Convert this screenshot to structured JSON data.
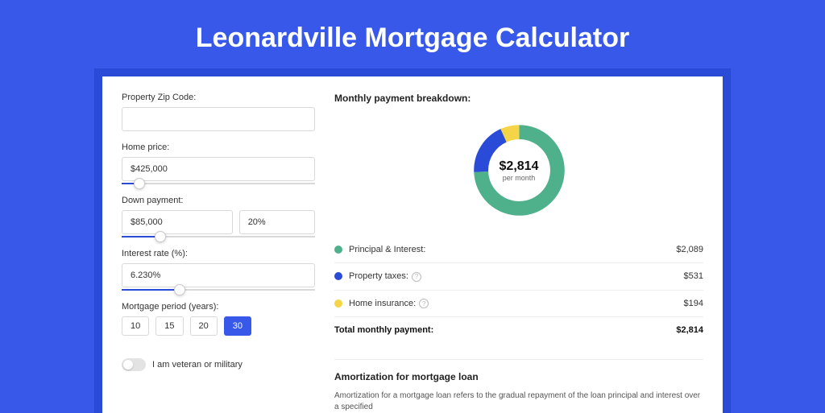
{
  "title": "Leonardville Mortgage Calculator",
  "form": {
    "zip_label": "Property Zip Code:",
    "zip_value": "",
    "home_price_label": "Home price:",
    "home_price_value": "$425,000",
    "home_price_slider_pct": 9,
    "down_payment_label": "Down payment:",
    "down_payment_amount": "$85,000",
    "down_payment_percent": "20%",
    "down_payment_slider_pct": 20,
    "interest_label": "Interest rate (%):",
    "interest_value": "6.230%",
    "interest_slider_pct": 30,
    "period_label": "Mortgage period (years):",
    "periods": [
      "10",
      "15",
      "20",
      "30"
    ],
    "period_active_index": 3,
    "veteran_label": "I am veteran or military"
  },
  "breakdown": {
    "title": "Monthly payment breakdown:",
    "total_amount": "$2,814",
    "total_sub": "per month",
    "items": [
      {
        "label": "Principal & Interest:",
        "value": "$2,089",
        "color": "#4fb08c",
        "help": false
      },
      {
        "label": "Property taxes:",
        "value": "$531",
        "color": "#2a4bd7",
        "help": true
      },
      {
        "label": "Home insurance:",
        "value": "$194",
        "color": "#f5d547",
        "help": true
      }
    ],
    "total_label": "Total monthly payment:",
    "total_value": "$2,814"
  },
  "amortization": {
    "title": "Amortization for mortgage loan",
    "body": "Amortization for a mortgage loan refers to the gradual repayment of the loan principal and interest over a specified"
  },
  "chart_data": {
    "type": "pie",
    "title": "Monthly payment breakdown",
    "series": [
      {
        "name": "Principal & Interest",
        "value": 2089,
        "color": "#4fb08c"
      },
      {
        "name": "Property taxes",
        "value": 531,
        "color": "#2a4bd7"
      },
      {
        "name": "Home insurance",
        "value": 194,
        "color": "#f5d547"
      }
    ],
    "total": 2814,
    "center_label": "$2,814 per month"
  }
}
